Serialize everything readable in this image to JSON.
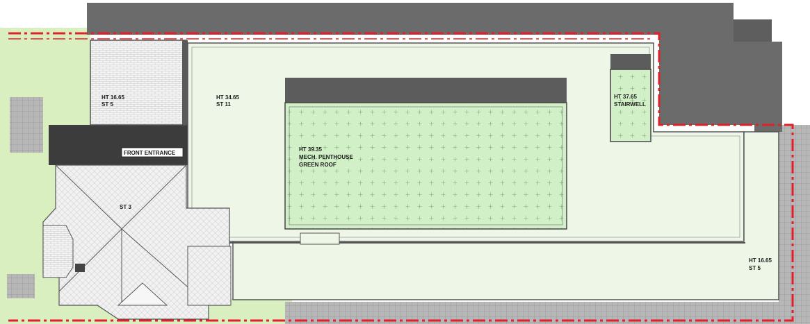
{
  "plan": {
    "labels": {
      "st5_left": {
        "ht": "HT 16.65",
        "st": "ST 5"
      },
      "st11": {
        "ht": "HT 34.65",
        "st": "ST 11"
      },
      "stairwell": {
        "ht": "HT 37.65",
        "name": "STAIRWELL"
      },
      "penthouse": {
        "ht": "HT 39.35",
        "name": "MECH. PENTHOUSE",
        "roof": "GREEN ROOF"
      },
      "front_entrance": "FRONT ENTRANCE",
      "st3": "ST 3",
      "st5_right": {
        "ht": "HT 16.65",
        "st": "ST 5"
      }
    },
    "colors": {
      "property_line": "#e0202a",
      "neighbor_roof": "#6b6b6b",
      "lawn": "#d9efc0",
      "roof_fill": "#eef6e8",
      "green_roof": "#d2f0c8",
      "sidewalk": "#b7b7b7"
    }
  }
}
